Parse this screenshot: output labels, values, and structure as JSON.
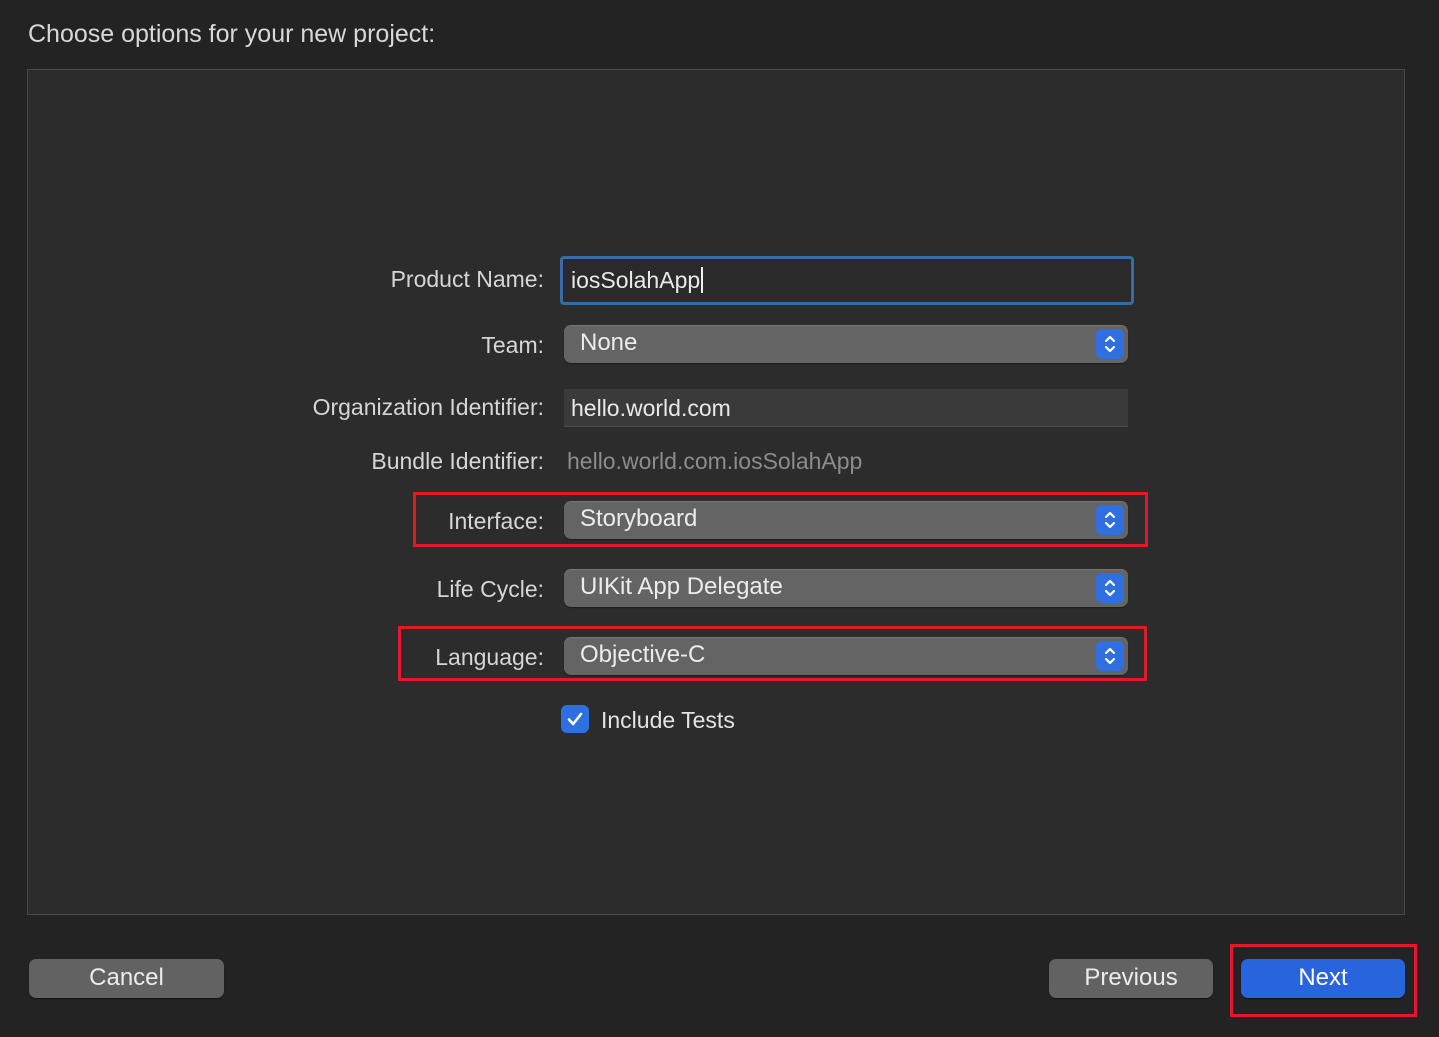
{
  "dialog": {
    "title": "Choose options for your new project:"
  },
  "form": {
    "product_name": {
      "label": "Product Name:",
      "value": "iosSolahApp"
    },
    "team": {
      "label": "Team:",
      "value": "None"
    },
    "organization_identifier": {
      "label": "Organization Identifier:",
      "value": "hello.world.com"
    },
    "bundle_identifier": {
      "label": "Bundle Identifier:",
      "value": "hello.world.com.iosSolahApp"
    },
    "interface": {
      "label": "Interface:",
      "value": "Storyboard"
    },
    "life_cycle": {
      "label": "Life Cycle:",
      "value": "UIKit App Delegate"
    },
    "language": {
      "label": "Language:",
      "value": "Objective-C"
    },
    "include_tests": {
      "label": "Include Tests",
      "checked": true
    }
  },
  "buttons": {
    "cancel": "Cancel",
    "previous": "Previous",
    "next": "Next"
  },
  "colors": {
    "accent": "#2f6fe0",
    "highlight": "#e21a26",
    "background": "#232323"
  }
}
